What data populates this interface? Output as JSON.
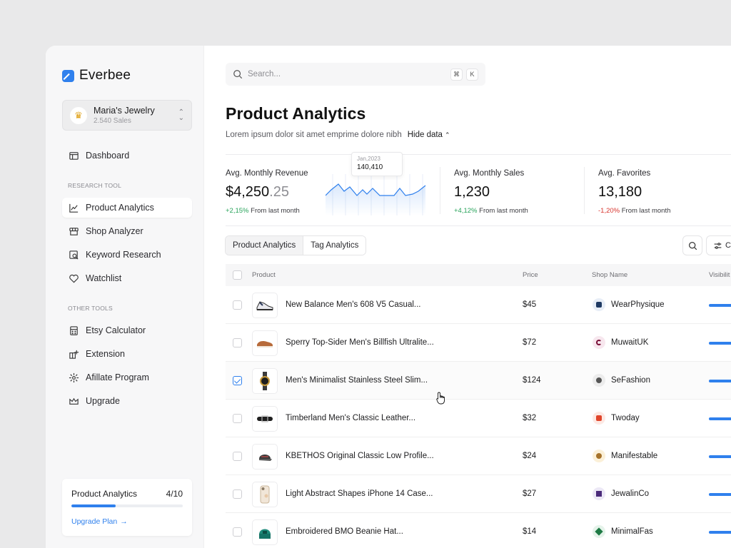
{
  "app": {
    "name": "Everbee"
  },
  "store": {
    "name": "Maria's Jewelry",
    "sales": "2.540 Sales"
  },
  "nav": {
    "dashboard": "Dashboard",
    "research_label": "RESEARCH TOOL",
    "research": [
      "Product Analytics",
      "Shop Analyzer",
      "Keyword Research",
      "Watchlist"
    ],
    "other_label": "OTHER TOOLS",
    "other": [
      "Etsy Calculator",
      "Extension",
      "Afillate Program",
      "Upgrade"
    ]
  },
  "plan": {
    "title": "Product Analytics",
    "count": "4/10",
    "progress": 0.4,
    "link": "Upgrade Plan"
  },
  "search": {
    "placeholder": "Search...",
    "key1": "⌘",
    "key2": "K"
  },
  "page": {
    "title": "Product Analytics",
    "subtitle": "Lorem ipsum dolor sit amet emprime dolore nibh",
    "toggle": "Hide data"
  },
  "stats": [
    {
      "label": "Avg. Monthly Revenue",
      "value_int": "$4,250",
      "value_dec": ".25",
      "change": "+2,15%",
      "direction": "up",
      "suffix": "From last month"
    },
    {
      "label": "Avg. Monthly Sales",
      "value_int": "1,230",
      "value_dec": "",
      "change": "+4,12%",
      "direction": "up",
      "suffix": "From last month"
    },
    {
      "label": "Avg. Favorites",
      "value_int": "13,180",
      "value_dec": "",
      "change": "-1,20%",
      "direction": "down",
      "suffix": "From last month"
    }
  ],
  "tooltip": {
    "date": "Jan,2023",
    "value": "140,410"
  },
  "tabs": [
    "Product Analytics",
    "Tag Analytics"
  ],
  "filter_label": "C",
  "table": {
    "columns": [
      "Product",
      "Price",
      "Shop Name",
      "Visibilit"
    ],
    "rows": [
      {
        "product": "New Balance Men's 608 V5 Casual...",
        "price": "$45",
        "shop": "WearPhysique",
        "checked": false
      },
      {
        "product": "Sperry Top-Sider Men's Billfish Ultralite...",
        "price": "$72",
        "shop": "MuwaitUK",
        "checked": false
      },
      {
        "product": "Men's Minimalist Stainless Steel Slim...",
        "price": "$124",
        "shop": "SeFashion",
        "checked": true
      },
      {
        "product": "Timberland Men's Classic Leather...",
        "price": "$32",
        "shop": "Twoday",
        "checked": false
      },
      {
        "product": "KBETHOS Original Classic Low Profile...",
        "price": "$24",
        "shop": "Manifestable",
        "checked": false
      },
      {
        "product": "Light Abstract Shapes iPhone 14 Case...",
        "price": "$27",
        "shop": "JewalinCo",
        "checked": false
      },
      {
        "product": "Embroidered BMO Beanie Hat...",
        "price": "$14",
        "shop": "MinimalFas",
        "checked": false
      }
    ]
  },
  "colors": {
    "accent": "#2f80ed",
    "positive": "#27a35a",
    "negative": "#d8342d"
  }
}
